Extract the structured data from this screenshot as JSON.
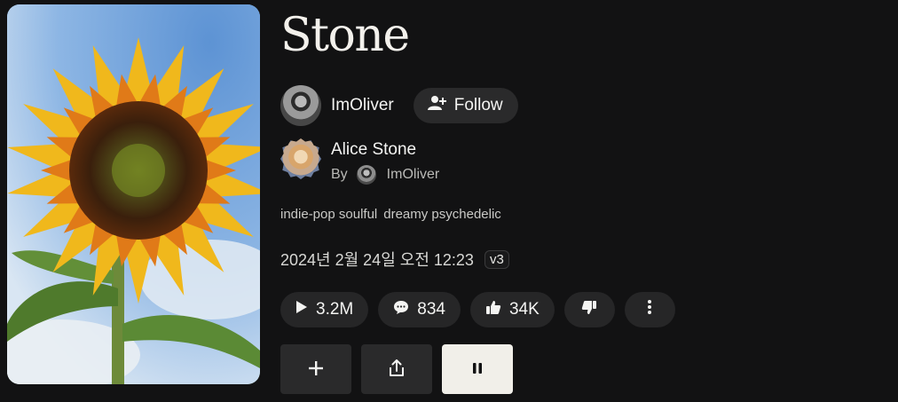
{
  "song": {
    "title": "Stone",
    "cover_icon": "sunflower-cover-art",
    "tags": [
      "indie-pop soulful",
      "dreamy psychedelic"
    ],
    "date": "2024년 2월 24일 오전 12:23",
    "version": "v3"
  },
  "creator": {
    "username": "ImOliver",
    "follow_label": "Follow",
    "follow_icon": "add-user-icon"
  },
  "artist": {
    "name": "Alice Stone",
    "by_label": "By",
    "by_username": "ImOliver"
  },
  "stats": {
    "plays": "3.2M",
    "comments": "834",
    "likes": "34K"
  },
  "actions": {
    "add_icon": "plus-icon",
    "share_icon": "share-icon",
    "pause_icon": "pause-icon"
  },
  "colors": {
    "background": "#121213",
    "pill": "#262627",
    "pause_button_bg": "#f1efe9"
  }
}
